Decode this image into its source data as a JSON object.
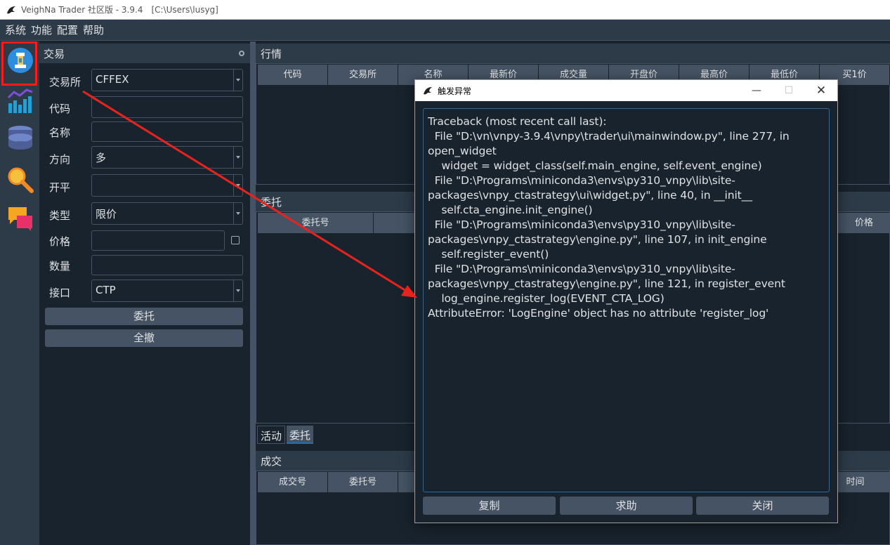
{
  "window": {
    "title": "VeighNa Trader 社区版 - 3.9.4",
    "path": "[C:\\Users\\lusyg]"
  },
  "menu": [
    "系统",
    "功能",
    "配置",
    "帮助"
  ],
  "toolbar": {
    "icons": [
      "trading-icon",
      "chart-icon",
      "database-icon",
      "search-icon",
      "chat-icon"
    ],
    "colors": {
      "highlight": "#ff1a1a",
      "accent": "#2b8ee0"
    }
  },
  "trade": {
    "title": "交易",
    "fields": [
      {
        "label": "交易所",
        "value": "CFFEX",
        "type": "combo"
      },
      {
        "label": "代码",
        "value": "",
        "type": "input"
      },
      {
        "label": "名称",
        "value": "",
        "type": "input"
      },
      {
        "label": "方向",
        "value": "多",
        "type": "combo"
      },
      {
        "label": "开平",
        "value": "",
        "type": "combo"
      },
      {
        "label": "类型",
        "value": "限价",
        "type": "combo"
      },
      {
        "label": "价格",
        "value": "",
        "type": "input"
      },
      {
        "label": "数量",
        "value": "",
        "type": "input"
      },
      {
        "label": "接口",
        "value": "CTP",
        "type": "combo"
      }
    ],
    "send_label": "委托",
    "cancel_all_label": "全撤"
  },
  "market": {
    "title": "行情",
    "columns": [
      "代码",
      "交易所",
      "名称",
      "最新价",
      "成交量",
      "开盘价",
      "最高价",
      "最低价",
      "买1价"
    ]
  },
  "orders": {
    "title": "委托",
    "columns": [
      "委托号",
      "价格"
    ],
    "tabs": [
      "活动",
      "委托"
    ]
  },
  "trades": {
    "title": "成交",
    "columns": [
      "成交号",
      "委托号",
      "时间"
    ]
  },
  "dialog": {
    "title": "触发异常",
    "traceback": "Traceback (most recent call last):\n  File \"D:\\vn\\vnpy-3.9.4\\vnpy\\trader\\ui\\mainwindow.py\", line 277, in\nopen_widget\n    widget = widget_class(self.main_engine, self.event_engine)\n  File \"D:\\Programs\\miniconda3\\envs\\py310_vnpy\\lib\\site-\npackages\\vnpy_ctastrategy\\ui\\widget.py\", line 40, in __init__\n    self.cta_engine.init_engine()\n  File \"D:\\Programs\\miniconda3\\envs\\py310_vnpy\\lib\\site-\npackages\\vnpy_ctastrategy\\engine.py\", line 107, in init_engine\n    self.register_event()\n  File \"D:\\Programs\\miniconda3\\envs\\py310_vnpy\\lib\\site-\npackages\\vnpy_ctastrategy\\engine.py\", line 121, in register_event\n    log_engine.register_log(EVENT_CTA_LOG)\nAttributeError: 'LogEngine' object has no attribute 'register_log'",
    "copy_label": "复制",
    "help_label": "求助",
    "close_label": "关闭"
  }
}
